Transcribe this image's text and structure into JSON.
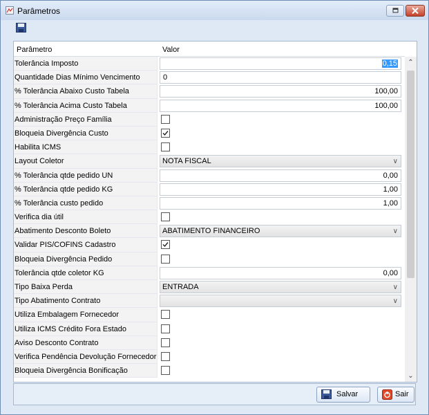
{
  "window": {
    "title": "Parâmetros",
    "accent_color": "#3399ff"
  },
  "grid": {
    "col_param": "Parâmetro",
    "col_value": "Valor",
    "rows": [
      {
        "name": "Tolerância Imposto",
        "type": "text",
        "align": "right",
        "value": "0,15",
        "selected": true
      },
      {
        "name": "Quantidade Dias Mínimo Vencimento",
        "type": "text",
        "align": "left",
        "value": "0"
      },
      {
        "name": "% Tolerância Abaixo Custo Tabela",
        "type": "text",
        "align": "right",
        "value": "100,00"
      },
      {
        "name": "% Tolerância Acima Custo Tabela",
        "type": "text",
        "align": "right",
        "value": "100,00"
      },
      {
        "name": "Administração Preço Família",
        "type": "check",
        "checked": false
      },
      {
        "name": "Bloqueia Divergência Custo",
        "type": "check",
        "checked": true
      },
      {
        "name": "Habilita ICMS",
        "type": "check",
        "checked": false
      },
      {
        "name": "Layout Coletor",
        "type": "combo",
        "value": "NOTA FISCAL"
      },
      {
        "name": "% Tolerância qtde pedido UN",
        "type": "text",
        "align": "right",
        "value": "0,00"
      },
      {
        "name": "% Tolerância qtde pedido KG",
        "type": "text",
        "align": "right",
        "value": "1,00"
      },
      {
        "name": "% Tolerância custo pedido",
        "type": "text",
        "align": "right",
        "value": "1,00"
      },
      {
        "name": "Verifica dia útil",
        "type": "check",
        "checked": false
      },
      {
        "name": "Abatimento Desconto Boleto",
        "type": "combo",
        "value": "ABATIMENTO FINANCEIRO"
      },
      {
        "name": "Validar PIS/COFINS Cadastro",
        "type": "check",
        "checked": true
      },
      {
        "name": "Bloqueia Divergência Pedido",
        "type": "check",
        "checked": false
      },
      {
        "name": "Tolerância qtde coletor KG",
        "type": "text",
        "align": "right",
        "value": "0,00"
      },
      {
        "name": "Tipo Baixa Perda",
        "type": "combo",
        "value": "ENTRADA"
      },
      {
        "name": "Tipo Abatimento Contrato",
        "type": "combo",
        "value": ""
      },
      {
        "name": "Utiliza Embalagem Fornecedor",
        "type": "check",
        "checked": false
      },
      {
        "name": "Utiliza ICMS Crédito Fora Estado",
        "type": "check",
        "checked": false
      },
      {
        "name": "Aviso Desconto Contrato",
        "type": "check",
        "checked": false
      },
      {
        "name": "Verifica Pendência Devolução Fornecedor",
        "type": "check",
        "checked": false
      },
      {
        "name": "Bloqueia Divergência Bonificação",
        "type": "check",
        "checked": false
      }
    ]
  },
  "footer": {
    "save_label": "Salvar",
    "exit_label": "Sair"
  }
}
